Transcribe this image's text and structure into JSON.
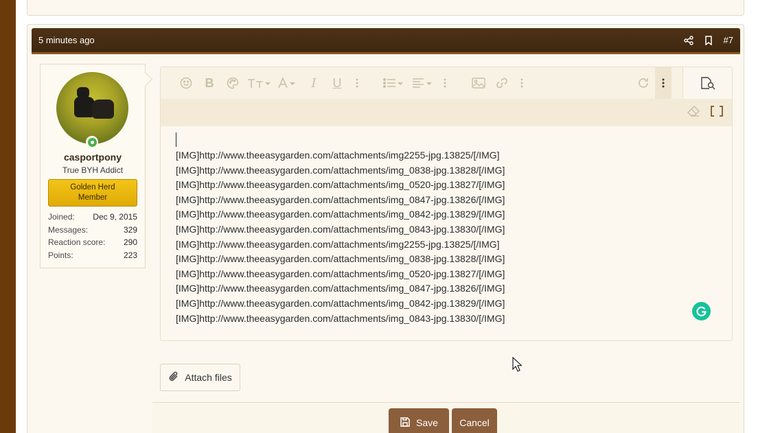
{
  "post": {
    "time": "5 minutes ago",
    "number": "#7"
  },
  "user": {
    "name": "casportpony",
    "title": "True BYH Addict",
    "banner": "Golden Herd Member",
    "stats": [
      {
        "label": "Joined:",
        "value": "Dec 9, 2015"
      },
      {
        "label": "Messages:",
        "value": "329"
      },
      {
        "label": "Reaction score:",
        "value": "290"
      },
      {
        "label": "Points:",
        "value": "223"
      }
    ]
  },
  "editor": {
    "lines": [
      "[IMG]http://www.theeasygarden.com/attachments/img2255-jpg.13825/[/IMG]",
      "[IMG]http://www.theeasygarden.com/attachments/img_0838-jpg.13828/[/IMG]",
      "[IMG]http://www.theeasygarden.com/attachments/img_0520-jpg.13827/[/IMG]",
      "[IMG]http://www.theeasygarden.com/attachments/img_0847-jpg.13826/[/IMG]",
      "[IMG]http://www.theeasygarden.com/attachments/img_0842-jpg.13829/[/IMG]",
      "[IMG]http://www.theeasygarden.com/attachments/img_0843-jpg.13830/[/IMG]",
      "[IMG]http://www.theeasygarden.com/attachments/img2255-jpg.13825/[/IMG]",
      "[IMG]http://www.theeasygarden.com/attachments/img_0838-jpg.13828/[/IMG]",
      "[IMG]http://www.theeasygarden.com/attachments/img_0520-jpg.13827/[/IMG]",
      "[IMG]http://www.theeasygarden.com/attachments/img_0847-jpg.13826/[/IMG]",
      "[IMG]http://www.theeasygarden.com/attachments/img_0842-jpg.13829/[/IMG]",
      "[IMG]http://www.theeasygarden.com/attachments/img_0843-jpg.13830/[/IMG]"
    ]
  },
  "actions": {
    "attach": "Attach files",
    "save": "Save",
    "cancel": "Cancel"
  },
  "colors": {
    "header": "#4e3215",
    "button": "#8b5e3c",
    "banner": "#f2c418",
    "online": "#4caf50",
    "grammarly": "#15c39a"
  }
}
